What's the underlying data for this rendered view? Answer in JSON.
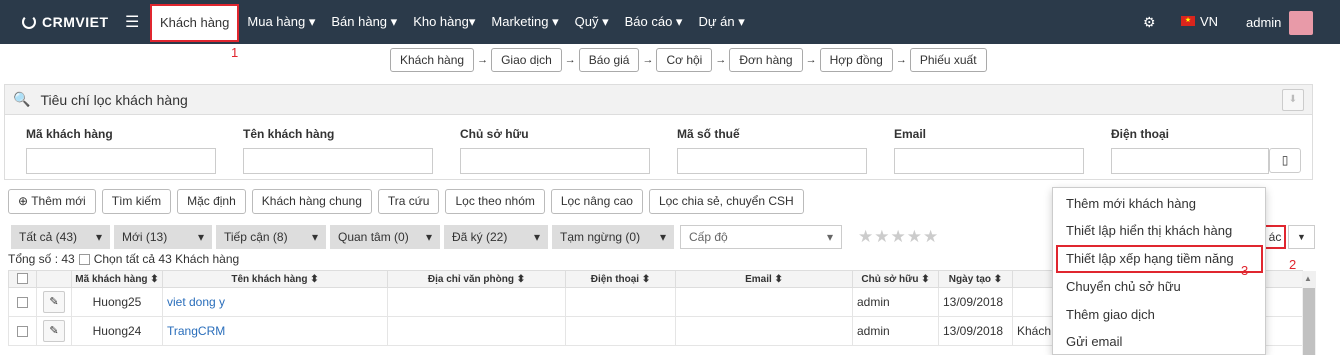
{
  "brand": "CRMVIET",
  "nav": [
    "Khách hàng",
    "Mua hàng",
    "Bán hàng",
    "Kho hàng",
    "Marketing",
    "Quỹ",
    "Báo cáo",
    "Dự án"
  ],
  "lang": "VN",
  "user": "admin",
  "annotations": [
    "1",
    "2",
    "3"
  ],
  "flow": [
    "Khách hàng",
    "Giao dịch",
    "Báo giá",
    "Cơ hội",
    "Đơn hàng",
    "Hợp đồng",
    "Phiếu xuất"
  ],
  "filter_title": "Tiêu chí lọc khách hàng",
  "fields": [
    "Mã khách hàng",
    "Tên khách hàng",
    "Chủ sở hữu",
    "Mã số thuế",
    "Email",
    "Điện thoại"
  ],
  "buttons": [
    "Thêm mới",
    "Tìm kiếm",
    "Mặc định",
    "Khách hàng chung",
    "Tra cứu",
    "Lọc theo nhóm",
    "Lọc nâng cao",
    "Lọc chia sẻ, chuyển CSH"
  ],
  "status_filters": [
    "Tất cả (43)",
    "Mới (13)",
    "Tiếp cận (8)",
    "Quan tâm (0)",
    "Đã ký (22)",
    "Tạm ngừng (0)"
  ],
  "level_placeholder": "Cấp độ",
  "total": "Tổng số : 43",
  "select_all": "Chọn tất cả 43 Khách hàng",
  "columns": [
    "Mã khách hàng ⬍",
    "Tên khách hàng ⬍",
    "Địa chỉ văn phòng ⬍",
    "Điện thoại ⬍",
    "Email ⬍",
    "Chủ sở hữu ⬍",
    "Ngày tạo ⬍"
  ],
  "rows": [
    {
      "code": "Huong25",
      "name": "viet dong y",
      "owner": "admin",
      "date": "13/09/2018",
      "extra": ""
    },
    {
      "code": "Huong24",
      "name": "TrangCRM",
      "owner": "admin",
      "date": "13/09/2018",
      "extra": "Khách"
    }
  ],
  "action_label": "ác",
  "menu": [
    "Thêm mới khách hàng",
    "Thiết lập hiển thị khách hàng",
    "Thiết lập xếp hạng tiềm năng",
    "Chuyển chủ sở hữu",
    "Thêm giao dịch",
    "Gửi email"
  ],
  "colors": {
    "topbar": "#2b3a4a",
    "annotation": "#e0262f",
    "link": "#2a6ebb"
  }
}
